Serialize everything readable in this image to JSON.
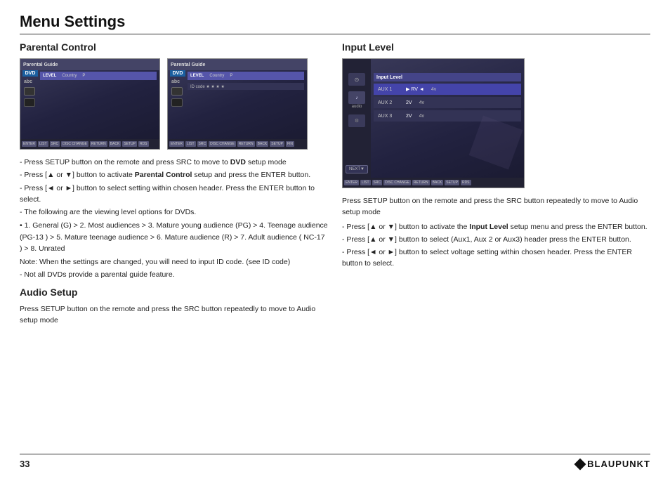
{
  "page": {
    "title": "Menu Settings",
    "page_number": "33"
  },
  "left_section": {
    "title": "Parental Control",
    "screenshot1": {
      "label": "Parental Guide screen 1",
      "dvd_label": "DVD",
      "abc_label": "abc",
      "title": "Parental Guide",
      "menu_items": [
        "LEVEL",
        "Country",
        "P"
      ]
    },
    "screenshot2": {
      "label": "Parental Guide screen 2",
      "dvd_label": "DVD",
      "abc_label": "abc",
      "title": "Parental Guide",
      "content": "ID code"
    },
    "body_lines": [
      "- Press SETUP button on the remote and press SRC to move to",
      "DVD setup mode",
      "- Press [▲ or ▼] button to activate Parental Control setup and",
      "press the ENTER button.",
      "- Press [◄ or ►] button to select setting within chosen header.",
      "Press the ENTER button to select.",
      "- The following are the viewing level options for DVDs."
    ],
    "bullet_lines": [
      "• 1. General (G) > 2. Most audiences > 3. Mature young audience",
      "(PG) > 4. Teenage audience (PG-13 ) > 5. Mature teenage",
      "audience > 6. Mature audience (R) > 7. Adult audience ( NC-17 )",
      "> 8. Unrated"
    ],
    "note_lines": [
      "Note: When the settings are changed, you will need to input ID",
      "code. (see ID code)",
      "- Not all DVDs provide a parental guide feature."
    ],
    "audio_setup": {
      "title": "Audio Setup",
      "body": "Press SETUP button on the remote and press the SRC button repeatedly to move to Audio setup mode"
    }
  },
  "right_section": {
    "title": "Input Level",
    "screenshot": {
      "label": "Input Level screen",
      "title": "Input Level",
      "sidebar_labels": [
        "audio"
      ],
      "rows": [
        {
          "label": "AUX 1",
          "value1": "▶ RV ◄",
          "value2": "4v",
          "highlight": true
        },
        {
          "label": "AUX 2",
          "value1": "2V",
          "value2": "4v",
          "highlight": false
        },
        {
          "label": "AUX 3",
          "value1": "2V",
          "value2": "4v",
          "highlight": false
        }
      ],
      "next_button": "NEXT"
    },
    "body_lines": [
      "Press SETUP button on the remote and press the SRC button",
      "repeatedly to move to Audio setup mode"
    ],
    "instructions": [
      "- Press [▲ or ▼] button to activate the Input Level setup menu and",
      "press the ENTER button.",
      "- Press [▲ or ▼] button to select (Aux1, Aux 2 or Aux3) header",
      "press the ENTER button.",
      "- Press [◄ or ►] button to select voltage setting within chosen",
      "header. Press the ENTER button to select."
    ]
  },
  "footer": {
    "page_number": "33",
    "brand": "BLAUPUNKT"
  }
}
